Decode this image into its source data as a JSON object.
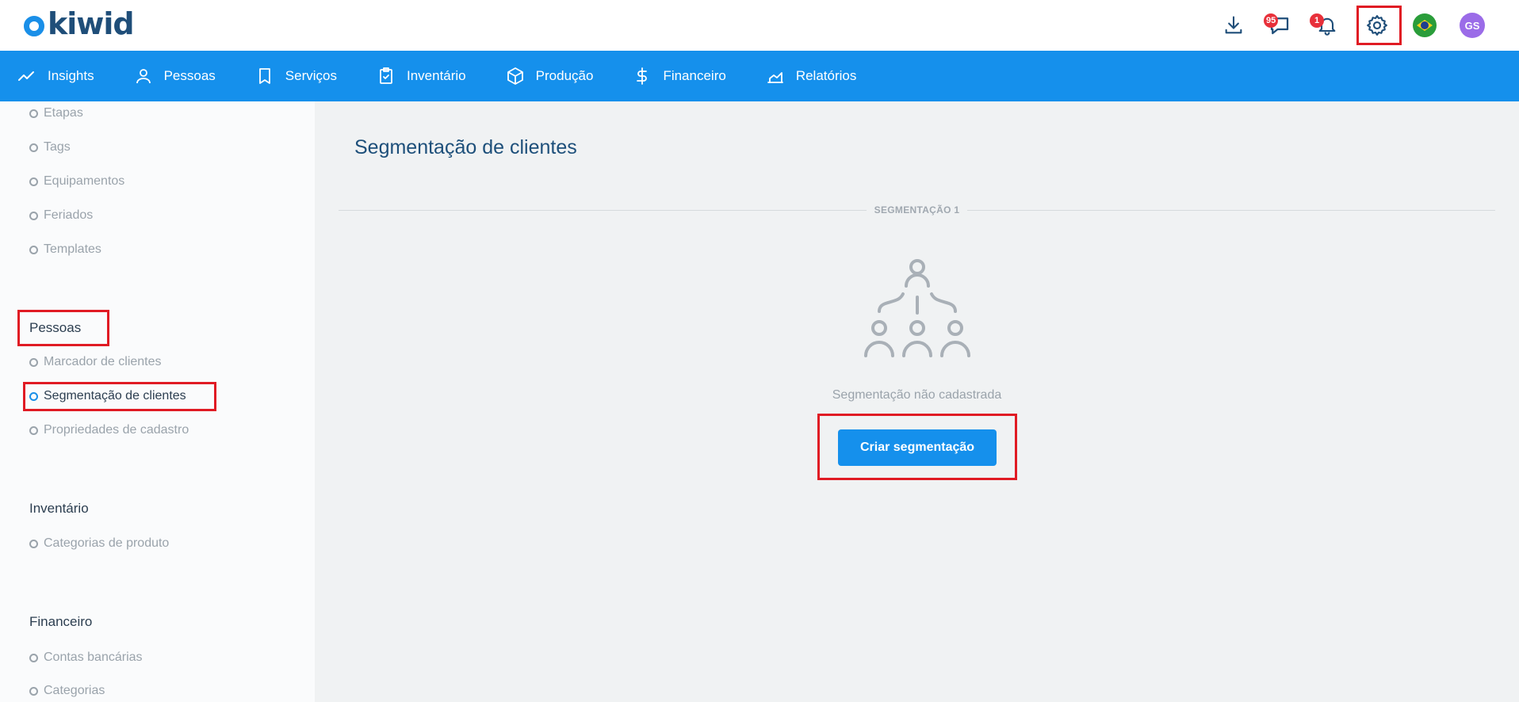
{
  "app": {
    "logo_text": "kiwid"
  },
  "topbar": {
    "icons": [
      "download-icon",
      "chat-icon",
      "bell-icon",
      "gear-icon",
      "flag-brazil-icon"
    ],
    "chat_badge": "95",
    "bell_badge": "1",
    "avatar_initials": "GS"
  },
  "nav": {
    "items": [
      {
        "label": "Insights",
        "icon": "trend-icon"
      },
      {
        "label": "Pessoas",
        "icon": "person-icon"
      },
      {
        "label": "Serviços",
        "icon": "bookmark-icon"
      },
      {
        "label": "Inventário",
        "icon": "clipboard-icon"
      },
      {
        "label": "Produção",
        "icon": "box-icon"
      },
      {
        "label": "Financeiro",
        "icon": "dollar-icon"
      },
      {
        "label": "Relatórios",
        "icon": "chart-icon"
      }
    ]
  },
  "sidebar": {
    "top_items": [
      "Etapas",
      "Tags",
      "Equipamentos",
      "Feriados",
      "Templates"
    ],
    "sections": [
      {
        "heading": "Pessoas",
        "items": [
          "Marcador de clientes",
          "Segmentação de clientes",
          "Propriedades de cadastro"
        ],
        "active": "Segmentação de clientes"
      },
      {
        "heading": "Inventário",
        "items": [
          "Categorias de produto"
        ]
      },
      {
        "heading": "Financeiro",
        "items": [
          "Contas bancárias",
          "Categorias"
        ]
      }
    ]
  },
  "main": {
    "title": "Segmentação de clientes",
    "divider_label": "SEGMENTAÇÃO 1",
    "empty_message": "Segmentação não cadastrada",
    "create_button": "Criar segmentação"
  },
  "colors": {
    "primary": "#1590ec",
    "highlight": "#e01b24",
    "title": "#1d4f7a"
  }
}
